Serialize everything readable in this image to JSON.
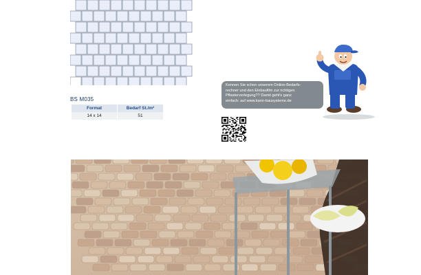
{
  "product": {
    "code": "BS M035",
    "table": {
      "headers": [
        "Format",
        "Bedarf St./m²"
      ],
      "rows": [
        [
          "14 x 14",
          "51"
        ]
      ]
    }
  },
  "promo": {
    "lines": [
      "Kennen Sie schon unserem Online-Bedarfs-",
      "rechner und den Einbaufilm zur richtigen",
      "Pflasterverlegung?? Damit geht's ganz",
      "einfach: auf www.kann-bausysteme.de"
    ]
  },
  "colors": {
    "accent_blue": "#1f4a86",
    "bubble_gray": "#838a8f",
    "overalls_blue": "#2a57b4"
  },
  "icons": [
    "paving-pattern-diagram",
    "qr-code",
    "worker-mascot-thumbs-up"
  ],
  "photo": {
    "subject": "paved patio with glass table, bowl of lemons and melon slices on a plate"
  }
}
